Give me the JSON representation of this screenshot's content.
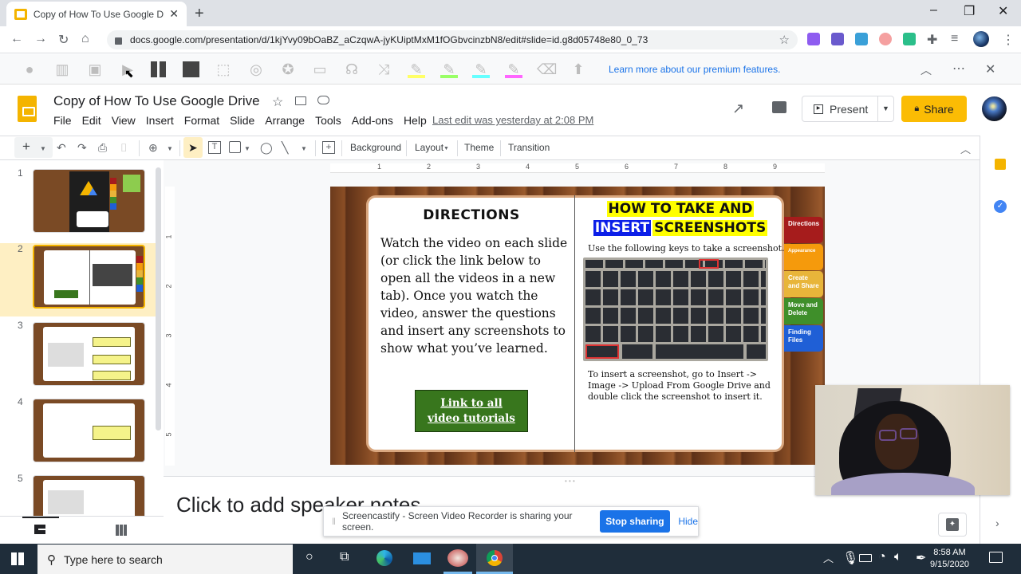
{
  "browser": {
    "tab_title": "Copy of How To Use Google Drive",
    "new_tab": "+",
    "url": "docs.google.com/presentation/d/1kjYvy09bOaBZ_aCzqwA-jyKUiptMxM1fOGbvcinzbN8/edit#slide=id.g8d05748e80_0_73",
    "window_controls": {
      "minimize": "–",
      "restore": "❐",
      "close": "✕"
    },
    "extensions": [
      {
        "name": "fw-extension",
        "color": "#8e5cf0"
      },
      {
        "name": "pdf-extension",
        "color": "#6a5acd"
      },
      {
        "name": "cloud-extension",
        "color": "#3aa0d8"
      },
      {
        "name": "screencastify-extension",
        "color": "#f06060"
      },
      {
        "name": "bitmoji-extension",
        "color": "#2bbf8a"
      }
    ]
  },
  "extension_toolbar": {
    "premium_link": "Learn more about our premium features.",
    "icons": [
      "head-icon",
      "book-icon",
      "image-icon",
      "play-icon",
      "pause-icon",
      "stop-icon",
      "select-icon",
      "headphones-icon",
      "globe-search-icon",
      "monitor-icon",
      "support-icon",
      "shuffle-icon",
      "highlighter-yellow-icon",
      "highlighter-green-icon",
      "highlighter-cyan-icon",
      "highlighter-pink-icon",
      "eraser-icon",
      "reader-icon"
    ],
    "highlight_colors": [
      "#ffff66",
      "#99ff66",
      "#66ffff",
      "#ff66ff"
    ]
  },
  "slides_header": {
    "title": "Copy of How To Use Google Drive",
    "menu": [
      "File",
      "Edit",
      "View",
      "Insert",
      "Format",
      "Slide",
      "Arrange",
      "Tools",
      "Add-ons",
      "Help"
    ],
    "last_edit": "Last edit was yesterday at 2:08 PM",
    "present_label": "Present",
    "share_label": "Share",
    "share_color": "#fbbc04"
  },
  "edit_toolbar": {
    "background": "Background",
    "layout": "Layout",
    "theme": "Theme",
    "transition": "Transition"
  },
  "rulers": {
    "horizontal": [
      "1",
      "2",
      "3",
      "4",
      "5",
      "6",
      "7",
      "8",
      "9"
    ],
    "vertical": [
      "1",
      "2",
      "3",
      "4",
      "5"
    ]
  },
  "filmstrip": {
    "slides": [
      {
        "number": "1",
        "selected": false
      },
      {
        "number": "2",
        "selected": true
      },
      {
        "number": "3",
        "selected": false
      },
      {
        "number": "4",
        "selected": false
      },
      {
        "number": "5",
        "selected": false
      }
    ]
  },
  "slide": {
    "directions_title": "DIRECTIONS",
    "directions_body": "Watch the video on each slide (or click the link below to open all the videos in a new tab). Once you watch the video, answer the questions and insert any screenshots to show what you’ve learned.",
    "link_line1": "Link to all",
    "link_line2": "video tutorials",
    "how_title_line1": "HOW TO TAKE AND",
    "how_title_insert": "INSERT",
    "how_title_screenshots": "SCREENSHOTS",
    "keys_line": "Use the following keys to take a screenshot.",
    "insert_text": "To insert a screenshot, go to Insert -> Image -> Upload From Google Drive and double click the screenshot to insert it.",
    "side_tabs": [
      {
        "label": "Directions",
        "color": "#a61c1c"
      },
      {
        "label": "Appearance",
        "color": "#f59a0c"
      },
      {
        "label": "Create and Share",
        "color": "#e8b53a"
      },
      {
        "label": "Move and Delete",
        "color": "#3f8f2a"
      },
      {
        "label": "Finding Files",
        "color": "#1f5fd6"
      }
    ]
  },
  "notes": {
    "placeholder": "Click to add speaker notes"
  },
  "screencastify_banner": {
    "message": "Screencastify - Screen Video Recorder is sharing your screen.",
    "stop_label": "Stop sharing",
    "hide_label": "Hide"
  },
  "taskbar": {
    "search_placeholder": "Type here to search",
    "time": "8:58 AM",
    "date": "9/15/2020"
  }
}
